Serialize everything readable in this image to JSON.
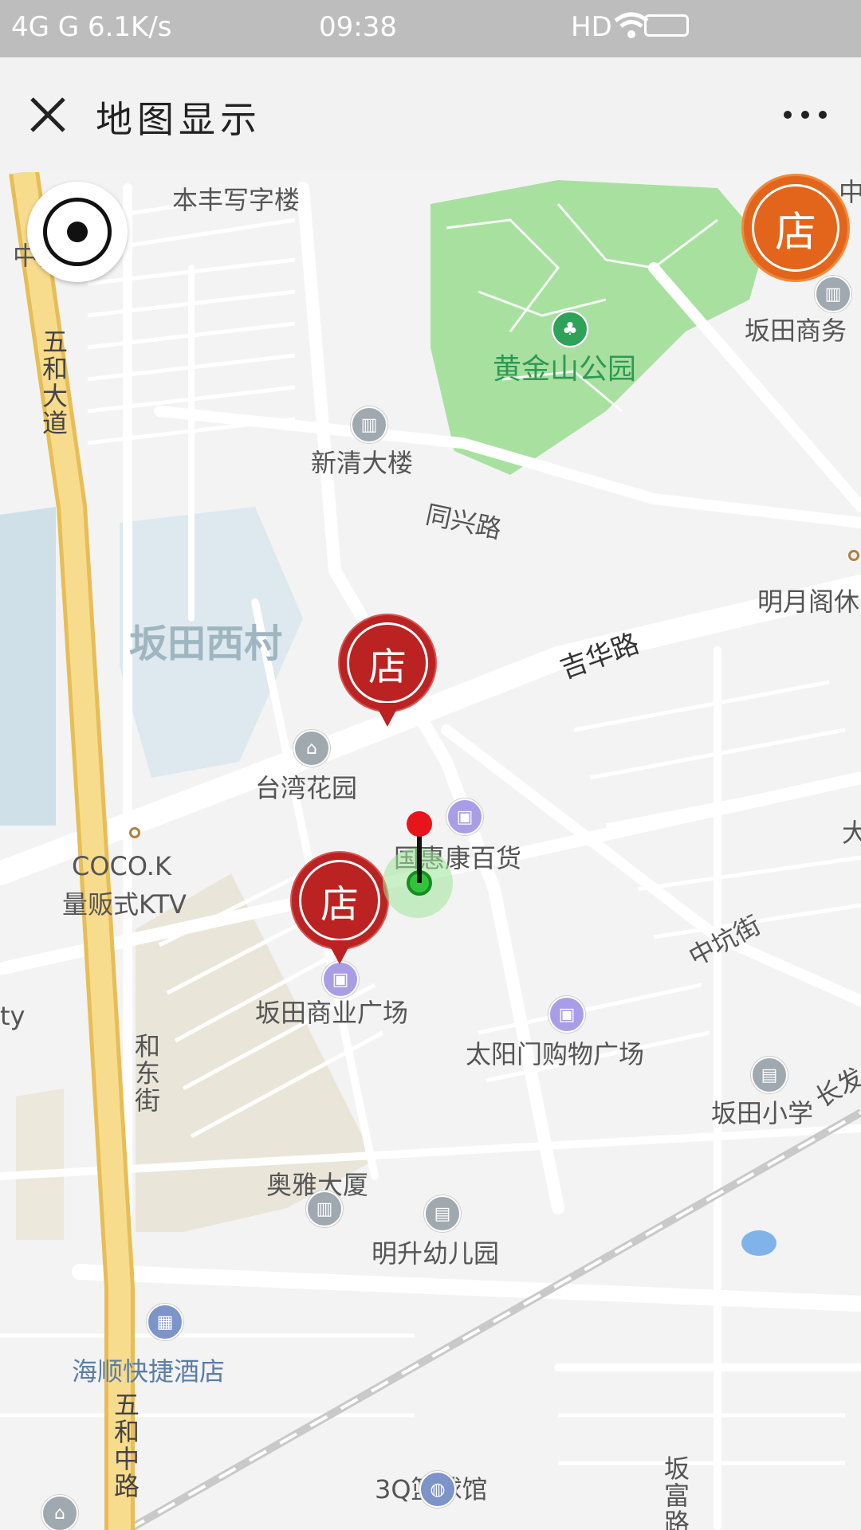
{
  "statusbar": {
    "left": "4G  G  6.1K/s",
    "time": "09:38",
    "right": "HD"
  },
  "header": {
    "title": "地图显示"
  },
  "map": {
    "labels": {
      "benfeng": "本丰写字楼",
      "bank": "中国银行",
      "wuhe_avenue": "五和大道",
      "park": "黄金山公园",
      "commerce": "坂田商务",
      "zhong": "中",
      "xinqing": "新清大楼",
      "tongxing": "同兴路",
      "mingyue": "明月阁休",
      "bantian_xicun": "坂田西村",
      "jihua": "吉华路",
      "taiwan_garden": "台湾花园",
      "guohui": "国惠康百货",
      "coco": "COCO.K",
      "ktv": "量贩式KTV",
      "zhongkeng": "中坑街",
      "bantian_plaza": "坂田商业广场",
      "hedong": "和东街",
      "taiyangmen": "太阳门购物广场",
      "bantian_school": "坂田小学",
      "chang": "长发",
      "aoya": "奥雅大厦",
      "mingsheng": "明升幼儿园",
      "haishun": "海顺快捷酒店",
      "wuhe_middle": "五和中路",
      "basketball": "3Q篮球馆",
      "banfu": "坂富路",
      "ty": "ty",
      "da": "大"
    },
    "shop_label": "店"
  },
  "colors": {
    "shop_red": "#bb2222",
    "shop_orange": "#e3651b",
    "park_green": "#a8e0a0",
    "highway": "#f5d27a"
  },
  "icons": [
    "close-icon",
    "more-icon",
    "locate-icon",
    "shop-marker-icon",
    "user-location-pin-icon"
  ]
}
